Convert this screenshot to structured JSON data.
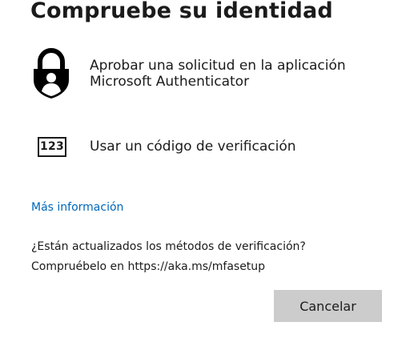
{
  "dialog": {
    "title": "Compruebe su identidad",
    "options": [
      {
        "icon": "authenticator-lock-icon",
        "line1": "Aprobar una solicitud en la aplicación",
        "line2": "Microsoft Authenticator"
      },
      {
        "icon": "verification-code-icon",
        "icon_text": "123",
        "label": "Usar un código de verificación"
      }
    ],
    "more_info_link": "Más información",
    "note_line1": "¿Están actualizados los métodos de verificación?",
    "note_line2": "Compruébelo en https://aka.ms/mfasetup",
    "cancel_label": "Cancelar"
  },
  "colors": {
    "link": "#0067b8",
    "text": "#1b1b1b",
    "button_bg": "#cccccc"
  }
}
